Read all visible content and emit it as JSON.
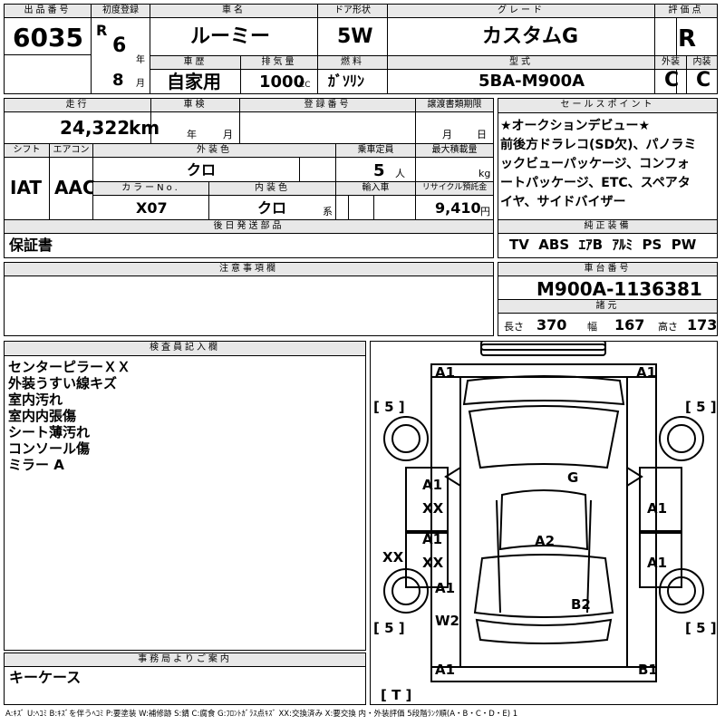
{
  "top": {
    "lot_label": "出品番号",
    "lot": "6035",
    "reg_label": "初度登録",
    "era": "R",
    "reg_year": "6",
    "year_unit": "年",
    "reg_month": "8",
    "month_unit": "月",
    "name_label": "車名",
    "name": "ルーミー",
    "door_label": "ドア形状",
    "door": "5W",
    "grade_label": "グレード",
    "grade": "カスタムG",
    "score_label": "評価点",
    "score": "R",
    "history_label": "車歴",
    "history": "自家用",
    "disp_label": "排気量",
    "disp": "1000",
    "disp_unit": "CC",
    "fuel_label": "燃料",
    "fuel": "ｶﾞｿﾘﾝ",
    "model_label": "型式",
    "model": "5BA-M900A",
    "ext_label": "外装",
    "ext": "C",
    "int_label": "内装",
    "int": "C"
  },
  "mid": {
    "mileage_label": "走行",
    "mileage": "24,322",
    "mileage_unit": "km",
    "inspect_label": "車検",
    "inspect_year": "年",
    "inspect_month": "月",
    "regno_label": "登録番号",
    "transfer_label": "譲渡書類期限",
    "transfer_month": "月",
    "transfer_day": "日",
    "shift_label": "シフト",
    "shift": "IAT",
    "ac_label": "エアコン",
    "ac": "AAC",
    "color_label": "外装色",
    "color": "クロ",
    "cap_label": "乗車定員",
    "cap": "5",
    "cap_unit": "人",
    "load_label": "最大積載量",
    "load_unit": "kg",
    "colorno_label": "カラーNo.",
    "colorno": "X07",
    "intcolor_label": "内装色",
    "intcolor": "クロ",
    "intcolor_unit": "系",
    "import_label": "輸入車",
    "recycle_label": "リサイクル預託金",
    "recycle": "9,410",
    "recycle_unit": "円",
    "later_label": "後日発送部品",
    "later": "保証書"
  },
  "sales": {
    "label": "セールスポイント",
    "lines": [
      "★オークションデビュー★",
      "前後方ドラレコ(SD欠)、パノラミ",
      "ックビューパッケージ、コンフォ",
      "ートパッケージ、ETC、スペアタ",
      "イヤ、サイドバイザー"
    ]
  },
  "equip": {
    "label": "純正装備",
    "items": [
      "TV",
      "ABS",
      "ｴｱB",
      "ｱﾙﾐ",
      "PS",
      "PW"
    ]
  },
  "notice": {
    "label": "注意事項欄"
  },
  "chassis": {
    "label": "車台番号",
    "value": "M900A-1136381"
  },
  "spec": {
    "label": "諸元",
    "len_label": "長さ",
    "len": "370",
    "wid_label": "幅",
    "wid": "167",
    "hgt_label": "高さ",
    "hgt": "173"
  },
  "inspector": {
    "label": "検査員記入欄",
    "lines": [
      "センターピラーＸＸ",
      "外装うすい線キズ",
      "室内汚れ",
      "室内内張傷",
      "シート薄汚れ",
      "コンソール傷",
      "ミラー A"
    ]
  },
  "office": {
    "label": "事務局よりご案内",
    "text": "キーケース"
  },
  "diagram": {
    "marks": [
      "A1",
      "A1",
      "[ 5 ]",
      "[ 5 ]",
      "G",
      "A1",
      "XX",
      "A1",
      "A1",
      "XX",
      "A1",
      "XX",
      "A2",
      "A1",
      "B2",
      "W2",
      "[ 5 ]",
      "[ 5 ]",
      "A1",
      "B1",
      "[ T ]"
    ]
  },
  "legend": "A:ｷｽﾞ U:ﾍｺﾐ B:ｷｽﾞを伴うﾍｺﾐ P:要塗装 W:補修跡 S:錆 C:腐食 G:ﾌﾛﾝﾄｶﾞﾗｽ点ｷｽﾞ XX:交換済み X:要交換 内・外装評価 5段階ﾗﾝｸ順(A・B・C・D・E) 1"
}
